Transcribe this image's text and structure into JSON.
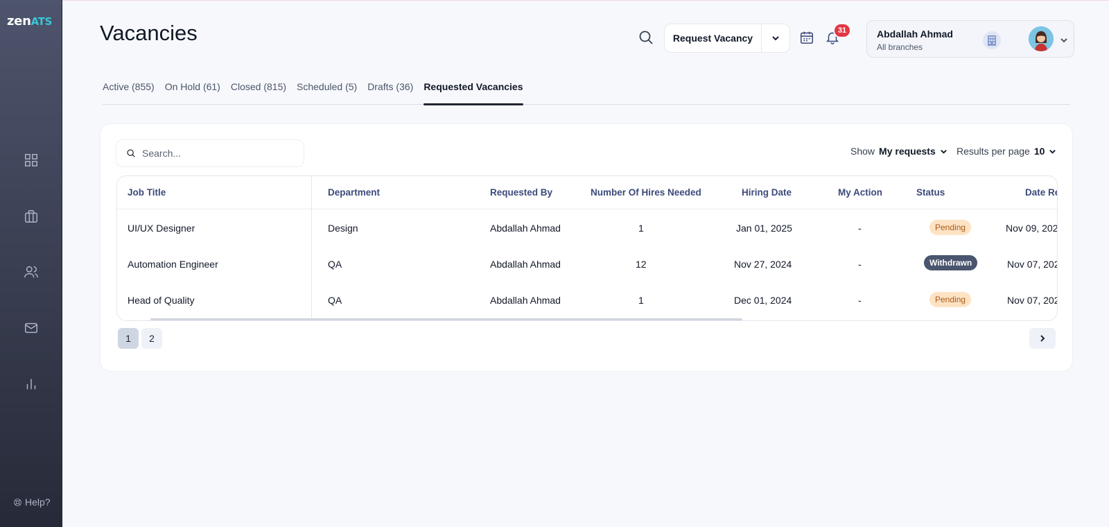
{
  "app": {
    "logo_zen": "zen",
    "logo_ats": "ATS",
    "help_label": "Help?"
  },
  "sidebar": {
    "items": [
      {
        "name": "dashboard",
        "icon": "grid-icon"
      },
      {
        "name": "jobs",
        "icon": "briefcase-icon"
      },
      {
        "name": "candidates",
        "icon": "users-icon"
      },
      {
        "name": "messages",
        "icon": "mail-icon"
      },
      {
        "name": "reports",
        "icon": "bar-chart-icon"
      }
    ]
  },
  "header": {
    "title": "Vacancies",
    "request_button": "Request Vacancy",
    "notification_count": "31",
    "user_name": "Abdallah Ahmad",
    "user_branch": "All branches"
  },
  "tabs": [
    {
      "label": "Active (855)",
      "active": false
    },
    {
      "label": "On Hold (61)",
      "active": false
    },
    {
      "label": "Closed (815)",
      "active": false
    },
    {
      "label": "Scheduled (5)",
      "active": false
    },
    {
      "label": "Drafts (36)",
      "active": false
    },
    {
      "label": "Requested Vacancies",
      "active": true
    }
  ],
  "toolbar": {
    "search_placeholder": "Search...",
    "show_label": "Show",
    "show_value": "My requests",
    "results_label": "Results per page",
    "results_value": "10"
  },
  "table": {
    "columns": [
      "Job Title",
      "Department",
      "Requested By",
      "Number Of Hires Needed",
      "Hiring Date",
      "My Action",
      "Status",
      "Date Re"
    ],
    "rows": [
      {
        "job_title": "UI/UX Designer",
        "department": "Design",
        "requested_by": "Abdallah Ahmad",
        "hires": "1",
        "hiring_date": "Jan 01, 2025",
        "my_action": "-",
        "status": "Pending",
        "date_requested": "Nov 09, 202"
      },
      {
        "job_title": "Automation Engineer",
        "department": "QA",
        "requested_by": "Abdallah Ahmad",
        "hires": "12",
        "hiring_date": "Nov 27, 2024",
        "my_action": "-",
        "status": "Withdrawn",
        "date_requested": "Nov 07, 202"
      },
      {
        "job_title": "Head of Quality",
        "department": "QA",
        "requested_by": "Abdallah Ahmad",
        "hires": "1",
        "hiring_date": "Dec 01, 2024",
        "my_action": "-",
        "status": "Pending",
        "date_requested": "Nov 07, 202"
      }
    ]
  },
  "pagination": {
    "pages": [
      "1",
      "2"
    ],
    "current": "1"
  },
  "colors": {
    "accent": "#3cc6d8",
    "badge": "#e23744",
    "pending_bg": "#fde3c4",
    "withdrawn_bg": "#4a556e",
    "header_text": "#3b4a7a"
  }
}
